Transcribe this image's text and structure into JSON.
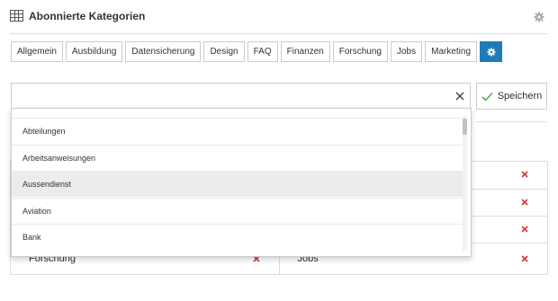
{
  "header": {
    "title": "Abonnierte Kategorien",
    "icons": {
      "table": "table-grid-icon",
      "settings": "gear-icon"
    }
  },
  "tabs": [
    {
      "label": "Allgemein"
    },
    {
      "label": "Ausbildung"
    },
    {
      "label": "Datensicherung"
    },
    {
      "label": "Design"
    },
    {
      "label": "FAQ"
    },
    {
      "label": "Finanzen"
    },
    {
      "label": "Forschung"
    },
    {
      "label": "Jobs"
    },
    {
      "label": "Marketing"
    },
    {
      "icon": "gear-icon",
      "active": true
    }
  ],
  "search": {
    "value": "",
    "placeholder": "",
    "clear_icon": "close-icon"
  },
  "save_button": {
    "label": "Speichern",
    "icon": "check-icon"
  },
  "dropdown": {
    "items": [
      {
        "label": "Abteilungen"
      },
      {
        "label": "Arbeitsanweisungen"
      },
      {
        "label": "Aussendienst",
        "highlighted": true
      },
      {
        "label": "Aviation"
      },
      {
        "label": "Bank"
      }
    ]
  },
  "subscribed": {
    "rows": [
      {
        "left": "",
        "right": ""
      },
      {
        "left": "",
        "right": ""
      },
      {
        "left": "",
        "right": ""
      },
      {
        "left": "Forschung",
        "right": "Jobs"
      }
    ],
    "remove_icon": "remove-x-icon"
  },
  "colors": {
    "accent": "#1f7bb8",
    "remove": "#d9343a",
    "check": "#4caf50"
  }
}
